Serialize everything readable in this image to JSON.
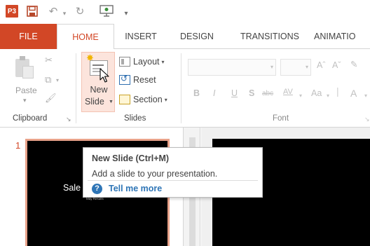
{
  "quick_access": {
    "app_logo": "P3",
    "icons": [
      "powerpoint-logo-icon",
      "save-icon",
      "undo-icon",
      "redo-icon",
      "start-from-beginning-icon",
      "customize-qat-icon"
    ]
  },
  "tabs": [
    {
      "label": "FILE"
    },
    {
      "label": "HOME"
    },
    {
      "label": "INSERT"
    },
    {
      "label": "DESIGN"
    },
    {
      "label": "TRANSITIONS"
    },
    {
      "label": "ANIMATIO"
    }
  ],
  "ribbon": {
    "clipboard": {
      "paste_label": "Paste",
      "group_label": "Clipboard"
    },
    "slides": {
      "new_slide_line1": "New",
      "new_slide_line2": "Slide",
      "layout_label": "Layout",
      "reset_label": "Reset",
      "section_label": "Section",
      "group_label": "Slides"
    },
    "font": {
      "group_label": "Font",
      "font_name_value": "",
      "font_size_value": "",
      "buttons": [
        "B",
        "I",
        "U",
        "S",
        "abc",
        "AV",
        "Aa",
        "A"
      ]
    }
  },
  "tooltip": {
    "title": "New Slide (Ctrl+M)",
    "description": "Add a slide to your presentation.",
    "link": "Tell me more"
  },
  "thumbnails": {
    "slide_number": "1",
    "title_text": "Sale",
    "subtitle_text": "May Results"
  },
  "colors": {
    "accent": "#d24726",
    "selected_button_bg": "#fce4dc",
    "link": "#2e75b6",
    "slide_bg": "#000000"
  }
}
